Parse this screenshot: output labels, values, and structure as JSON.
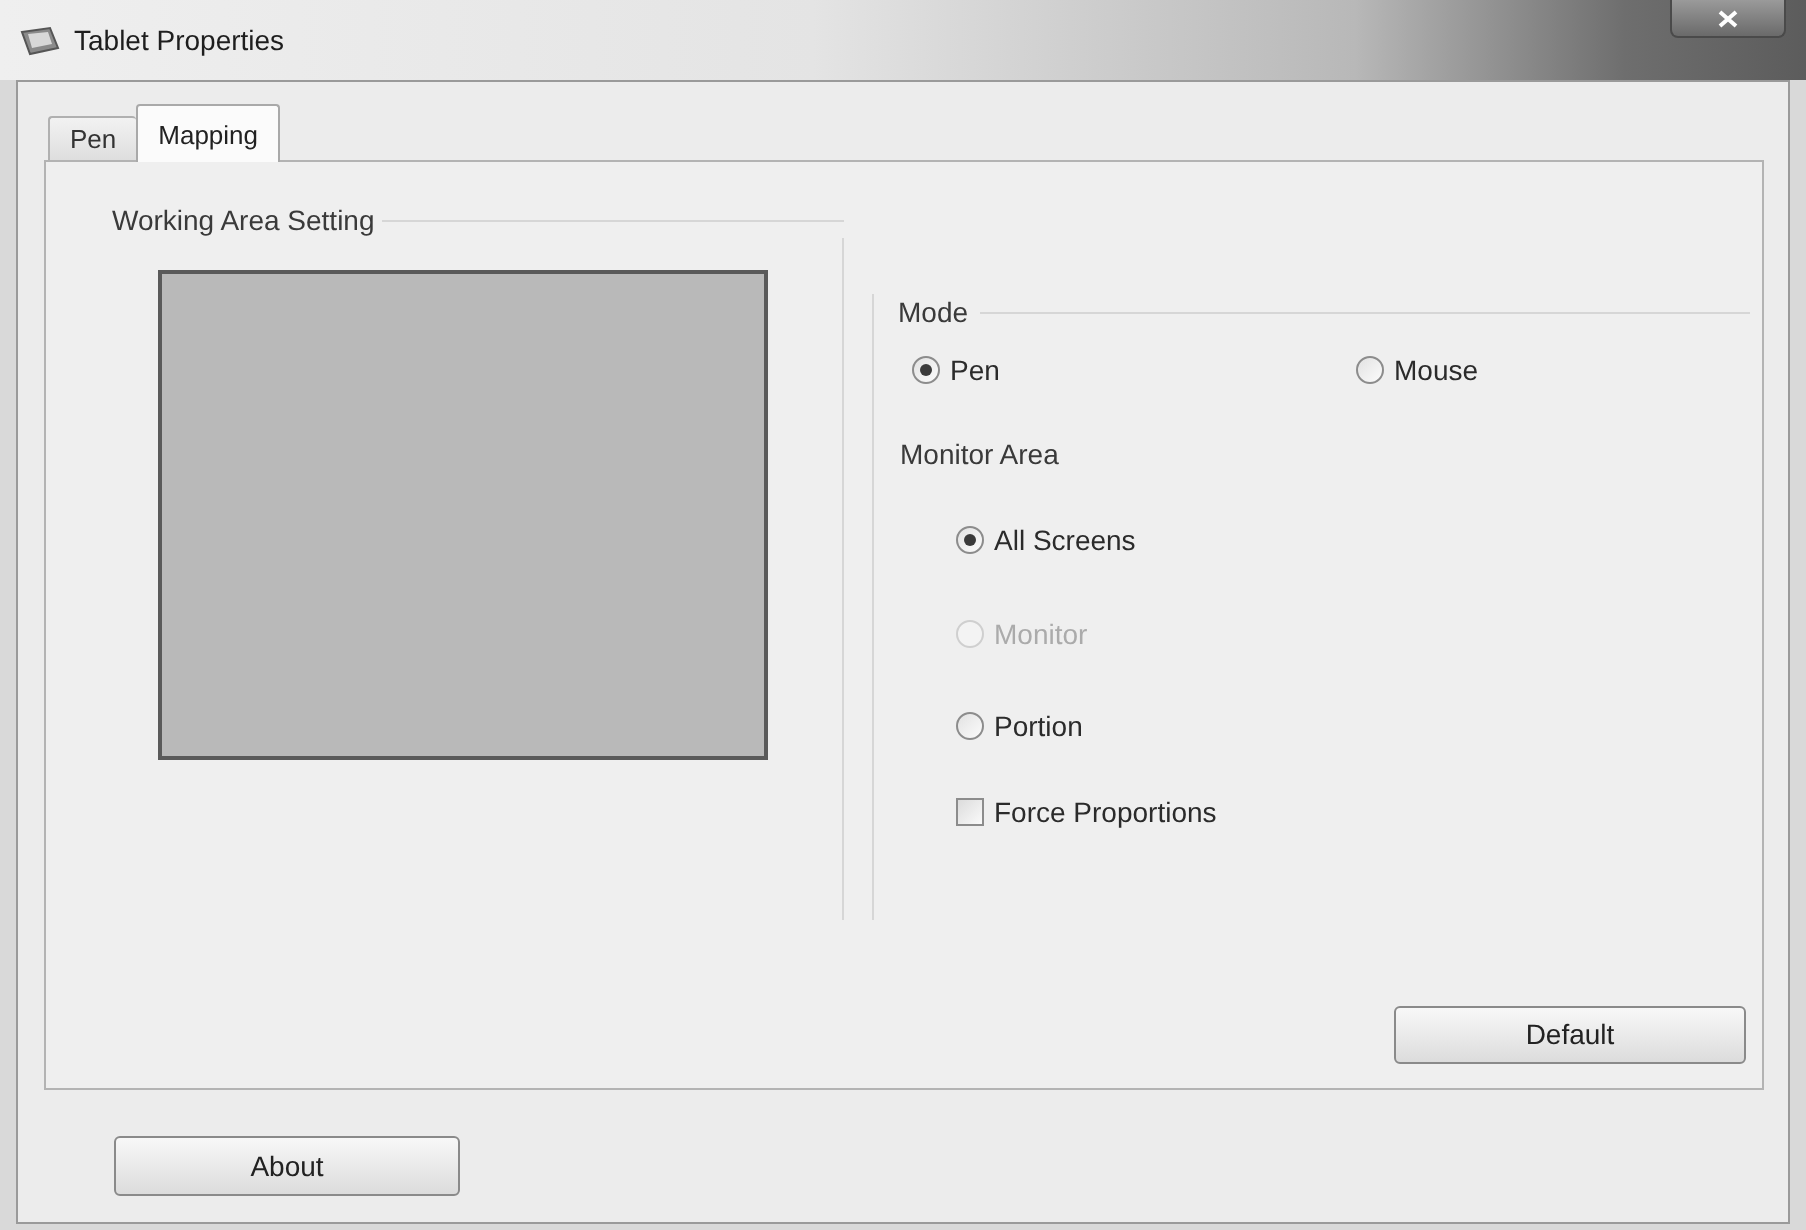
{
  "window": {
    "title": "Tablet Properties"
  },
  "tabs": [
    {
      "label": "Pen",
      "selected": false
    },
    {
      "label": "Mapping",
      "selected": true
    }
  ],
  "working_area": {
    "title": "Working Area Setting"
  },
  "mode": {
    "title": "Mode",
    "options": [
      {
        "label": "Pen",
        "selected": true
      },
      {
        "label": "Mouse",
        "selected": false
      }
    ]
  },
  "monitor_area": {
    "title": "Monitor Area",
    "options": [
      {
        "label": "All Screens",
        "selected": true,
        "disabled": false
      },
      {
        "label": "Monitor",
        "selected": false,
        "disabled": true
      },
      {
        "label": "Portion",
        "selected": false,
        "disabled": false
      }
    ],
    "force_proportions": {
      "label": "Force Proportions",
      "checked": false
    }
  },
  "buttons": {
    "default": "Default",
    "about": "About"
  }
}
